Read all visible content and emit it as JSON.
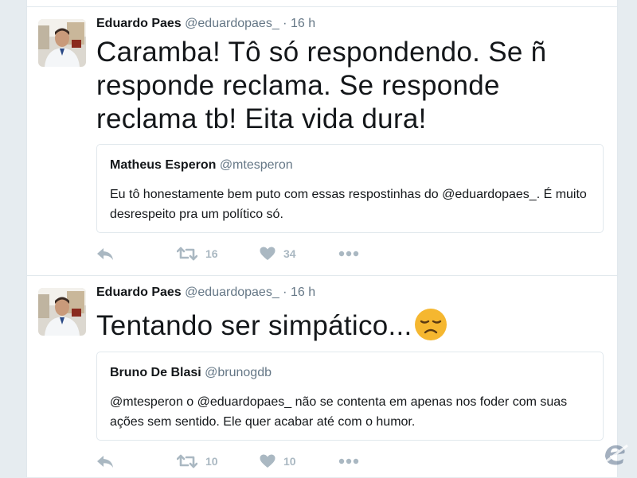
{
  "tweets": [
    {
      "author_name": "Eduardo Paes",
      "author_handle": "@eduardopaes_",
      "separator": "·",
      "time": "16 h",
      "text": "Caramba!  Tô só respondendo.  Se ñ responde reclama.  Se responde reclama tb!  Eita vida dura!",
      "quoted": {
        "author_name": "Matheus Esperon",
        "author_handle": "@mtesperon",
        "text": "Eu tô honestamente bem puto com essas respostinhas do @eduardopaes_. É muito desrespeito pra um político só."
      },
      "retweet_count": "16",
      "like_count": "34"
    },
    {
      "author_name": "Eduardo Paes",
      "author_handle": "@eduardopaes_",
      "separator": "·",
      "time": "16 h",
      "text": "Tentando ser simpático...",
      "emoji": "disappointed-face-emoji",
      "quoted": {
        "author_name": "Bruno De Blasi",
        "author_handle": "@brunogdb",
        "text": "@mtesperon o @eduardopaes_ não se contenta em apenas nos foder com suas ações sem sentido. Ele quer acabar até com o humor."
      },
      "retweet_count": "10",
      "like_count": "10"
    }
  ],
  "icons": {
    "reply": "reply-icon",
    "retweet": "retweet-icon",
    "like": "heart-icon",
    "more": "more-options-icon"
  },
  "colors": {
    "background": "#e6ecf0",
    "card": "#ffffff",
    "border": "#e1e8ed",
    "text": "#14171a",
    "secondary": "#657786",
    "action_gray": "#aab8c2",
    "emoji_yellow": "#f5b730"
  }
}
